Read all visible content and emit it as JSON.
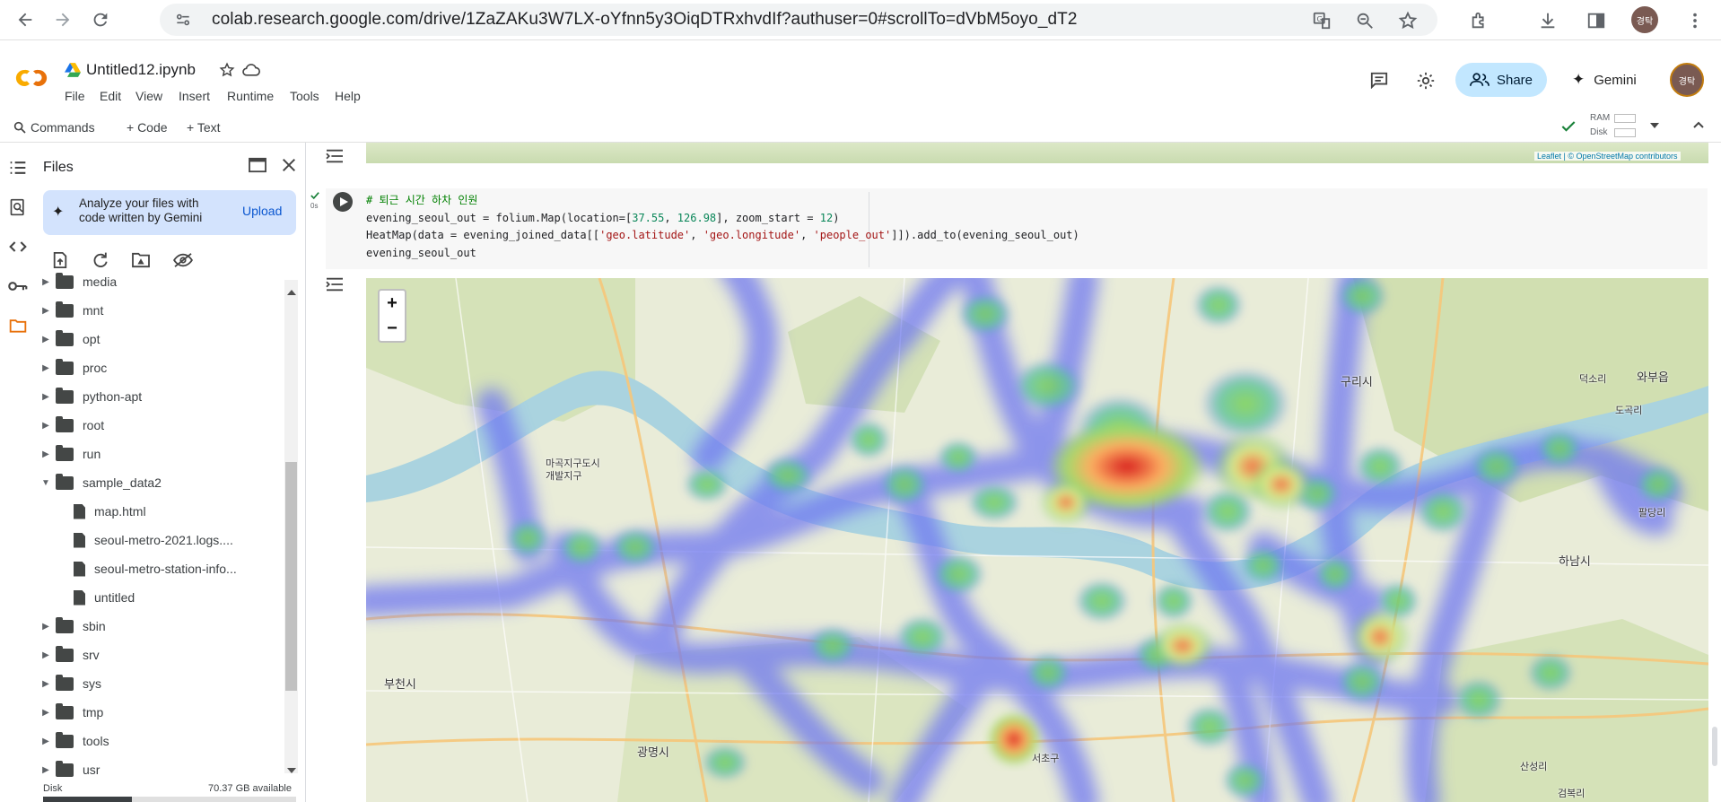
{
  "browser": {
    "url": "colab.research.google.com/drive/1ZaZAKu3W7LX-oYfnn5y3OiqDTRxhvdIf?authuser=0#scrollTo=dVbM5oyo_dT2",
    "avatar_text": "경탁"
  },
  "header": {
    "notebook_title": "Untitled12.ipynb",
    "menu": [
      "File",
      "Edit",
      "View",
      "Insert",
      "Runtime",
      "Tools",
      "Help"
    ],
    "share_label": "Share",
    "gemini_label": "Gemini",
    "avatar_text": "경탁"
  },
  "toolbar": {
    "commands_label": "Commands",
    "code_label": "+ Code",
    "text_label": "+ Text",
    "ram_label": "RAM",
    "disk_label": "Disk"
  },
  "files_panel": {
    "title": "Files",
    "gemini_prompt": "Analyze your files with code written by Gemini",
    "upload_label": "Upload",
    "tree": [
      {
        "name": "media",
        "type": "folder",
        "expanded": false,
        "indent": 0
      },
      {
        "name": "mnt",
        "type": "folder",
        "expanded": false,
        "indent": 0
      },
      {
        "name": "opt",
        "type": "folder",
        "expanded": false,
        "indent": 0
      },
      {
        "name": "proc",
        "type": "folder",
        "expanded": false,
        "indent": 0
      },
      {
        "name": "python-apt",
        "type": "folder",
        "expanded": false,
        "indent": 0
      },
      {
        "name": "root",
        "type": "folder",
        "expanded": false,
        "indent": 0
      },
      {
        "name": "run",
        "type": "folder",
        "expanded": false,
        "indent": 0
      },
      {
        "name": "sample_data2",
        "type": "folder",
        "expanded": true,
        "indent": 0
      },
      {
        "name": "map.html",
        "type": "file",
        "indent": 1
      },
      {
        "name": "seoul-metro-2021.logs....",
        "type": "file",
        "indent": 1
      },
      {
        "name": "seoul-metro-station-info...",
        "type": "file",
        "indent": 1
      },
      {
        "name": "untitled",
        "type": "file",
        "indent": 1
      },
      {
        "name": "sbin",
        "type": "folder",
        "expanded": false,
        "indent": 0
      },
      {
        "name": "srv",
        "type": "folder",
        "expanded": false,
        "indent": 0
      },
      {
        "name": "sys",
        "type": "folder",
        "expanded": false,
        "indent": 0
      },
      {
        "name": "tmp",
        "type": "folder",
        "expanded": false,
        "indent": 0
      },
      {
        "name": "tools",
        "type": "folder",
        "expanded": false,
        "indent": 0
      },
      {
        "name": "usr",
        "type": "folder",
        "expanded": false,
        "indent": 0
      }
    ],
    "disk_label": "Disk",
    "disk_available": "70.37 GB available"
  },
  "cell": {
    "exec_time": "0s",
    "code_comment": "# 퇴근 시간 하차 인원",
    "code_line1_a": "evening_seoul_out = folium.Map(location=[",
    "code_line1_num1": "37.55",
    "code_line1_sep": ", ",
    "code_line1_num2": "126.98",
    "code_line1_b": "], zoom_start = ",
    "code_line1_num3": "12",
    "code_line1_c": ")",
    "code_line2_a": "HeatMap(data = evening_joined_data[[",
    "code_line2_s1": "'geo.latitude'",
    "code_line2_s2": "'geo.longitude'",
    "code_line2_s3": "'people_out'",
    "code_line2_b": "]]).add_to(evening_seoul_out)",
    "code_line3": "evening_seoul_out"
  },
  "map": {
    "attribution": "Leaflet | © OpenStreetMap contributors",
    "zoom_in": "+",
    "zoom_out": "−",
    "labels": [
      "마곡지구도시\n개발지구",
      "부천시",
      "광명시",
      "구리시",
      "하남시",
      "덕소리",
      "와부읍",
      "도곡리",
      "팔당리",
      "서초구",
      "산성리",
      "검복리"
    ]
  }
}
